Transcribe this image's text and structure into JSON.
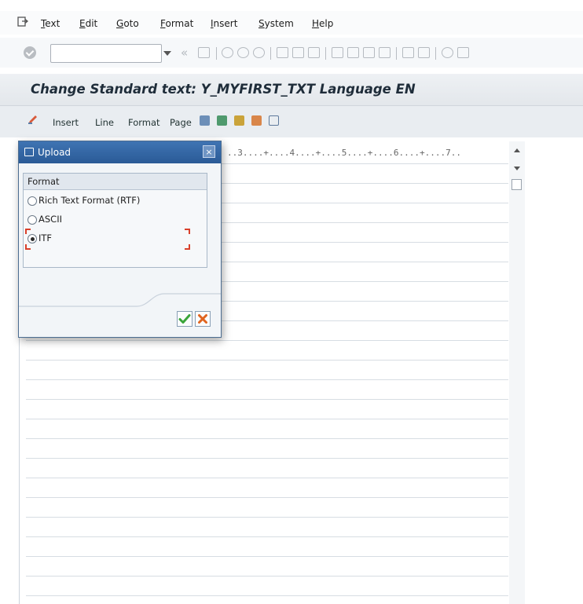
{
  "menubar": {
    "items": [
      {
        "label": "Text",
        "accel": "T"
      },
      {
        "label": "Edit",
        "accel": "E"
      },
      {
        "label": "Goto",
        "accel": "G"
      },
      {
        "label": "Format",
        "accel": "F"
      },
      {
        "label": "Insert",
        "accel": "I"
      },
      {
        "label": "System",
        "accel": "S"
      },
      {
        "label": "Help",
        "accel": "H"
      }
    ]
  },
  "toolbar": {
    "command_field_value": "",
    "arrows": "«"
  },
  "header": {
    "title": "Change Standard text: Y_MYFIRST_TXT Language EN"
  },
  "app_toolbar": {
    "insert": "Insert",
    "line": "Line",
    "format": "Format",
    "page": "Page"
  },
  "editor": {
    "ruler": "..3....+....4....+....5....+....6....+....7.."
  },
  "dialog": {
    "title": "Upload",
    "close": "×",
    "group_title": "Format",
    "options": [
      {
        "label": "Rich Text Format (RTF)",
        "selected": false
      },
      {
        "label": "ASCII",
        "selected": false
      },
      {
        "label": "ITF",
        "selected": true
      }
    ],
    "ok_icon": "checkmark-icon",
    "cancel_icon": "cancel-x-icon"
  },
  "colors": {
    "dialog_header": "#2f639f",
    "ok_green": "#3aa53a",
    "cancel_orange": "#e0641f",
    "focus_red": "#d9402b"
  }
}
